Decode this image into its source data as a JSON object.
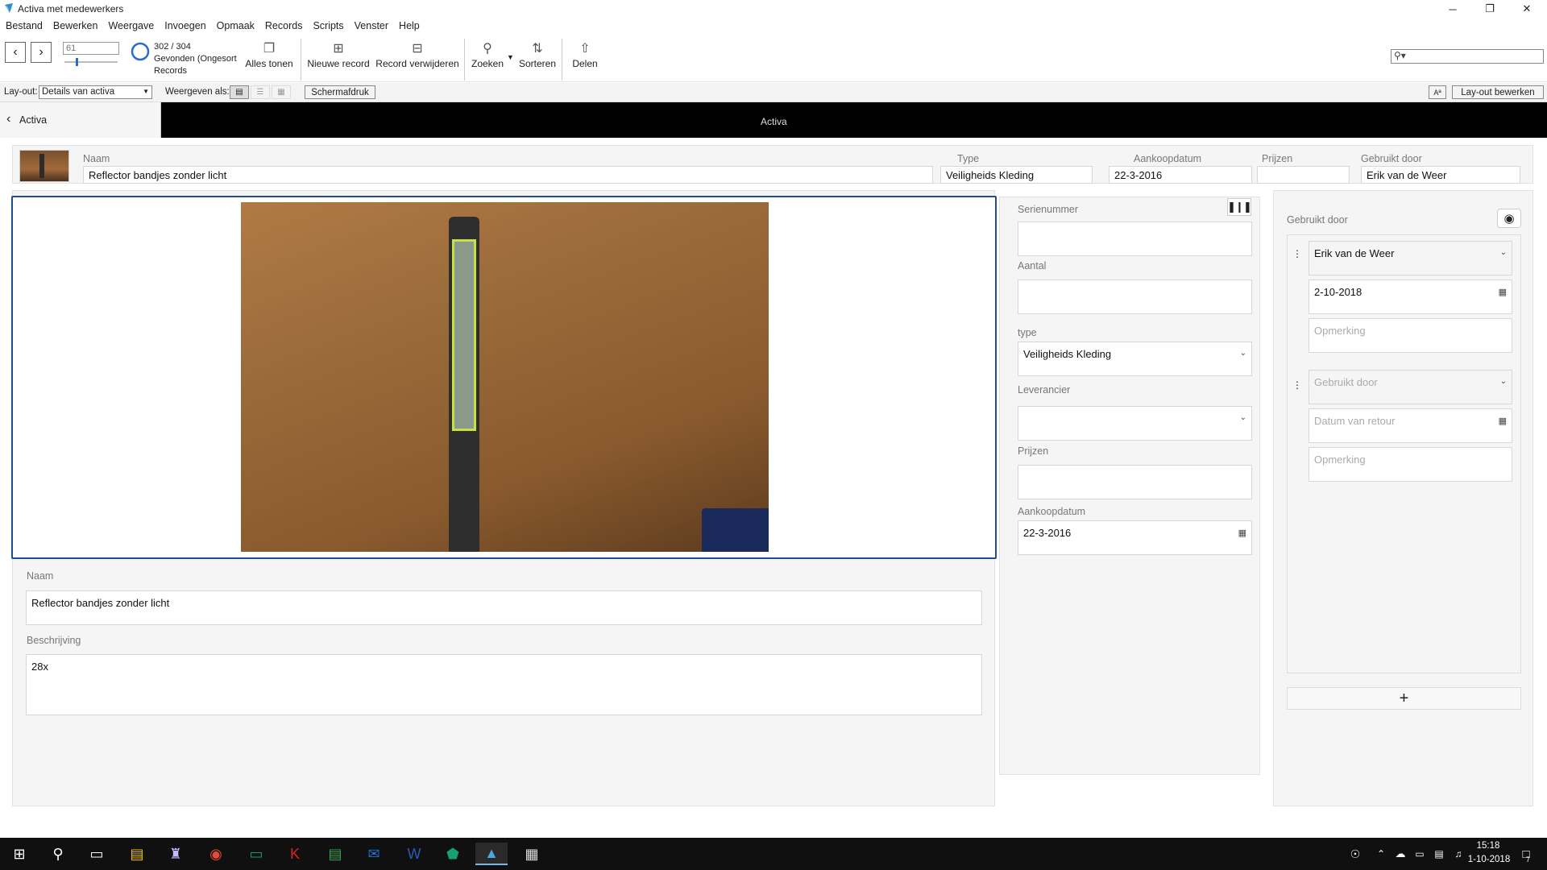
{
  "window": {
    "title": "Activa met medewerkers",
    "minimize": "─",
    "restore": "❐",
    "close": "✕"
  },
  "menu": [
    "Bestand",
    "Bewerken",
    "Weergave",
    "Invoegen",
    "Opmaak",
    "Records",
    "Scripts",
    "Venster",
    "Help"
  ],
  "toolbar": {
    "record_number": "61",
    "found_count": "302 / 304",
    "found_label": "Gevonden (Ongesort",
    "records_label": "Records",
    "show_all": "Alles tonen",
    "new_record": "Nieuwe record",
    "delete_record": "Record verwijderen",
    "search": "Zoeken",
    "sort": "Sorteren",
    "share": "Delen",
    "quick_search_placeholder": ""
  },
  "layoutbar": {
    "layout_label": "Lay-out:",
    "layout_value": "Details van activa",
    "view_as_label": "Weergeven als:",
    "preview_button": "Schermafdruk",
    "font_button": "Aª",
    "edit_layout_button": "Lay-out bewerken"
  },
  "header": {
    "back_label": "Activa",
    "title": "Activa"
  },
  "summary": {
    "naam_label": "Naam",
    "naam_value": "Reflector bandjes zonder licht",
    "type_label": "Type",
    "type_value": "Veiligheids Kleding",
    "aankoopdatum_label": "Aankoopdatum",
    "aankoopdatum_value": "22-3-2016",
    "prijzen_label": "Prijzen",
    "prijzen_value": "",
    "gebruikt_label": "Gebruikt door",
    "gebruikt_value": "Erik van de Weer"
  },
  "detail": {
    "naam_label": "Naam",
    "naam_value": "Reflector bandjes zonder licht",
    "beschrijving_label": "Beschrijving",
    "beschrijving_value": "28x"
  },
  "middle": {
    "serienummer_label": "Serienummer",
    "serienummer_value": "",
    "aantal_label": "Aantal",
    "aantal_value": "",
    "type_label": "type",
    "type_value": "Veiligheids Kleding",
    "leverancier_label": "Leverancier",
    "leverancier_value": "",
    "prijzen_label": "Prijzen",
    "prijzen_value": "",
    "aankoopdatum_label": "Aankoopdatum",
    "aankoopdatum_value": "22-3-2016"
  },
  "right": {
    "title": "Gebruikt door",
    "row1": {
      "person": "Erik van de Weer",
      "date": "2-10-2018",
      "note_placeholder": "Opmerking"
    },
    "row2": {
      "person_placeholder": "Gebruikt door",
      "date_placeholder": "Datum van retour",
      "note_placeholder": "Opmerking"
    },
    "add": "+"
  },
  "taskbar": {
    "time": "15:18",
    "date": "1-10-2018",
    "notifications": "7"
  },
  "colors": {
    "header_bg": "#000000",
    "focus_border": "#1f4e8c",
    "wood": "#9a6a3a"
  }
}
